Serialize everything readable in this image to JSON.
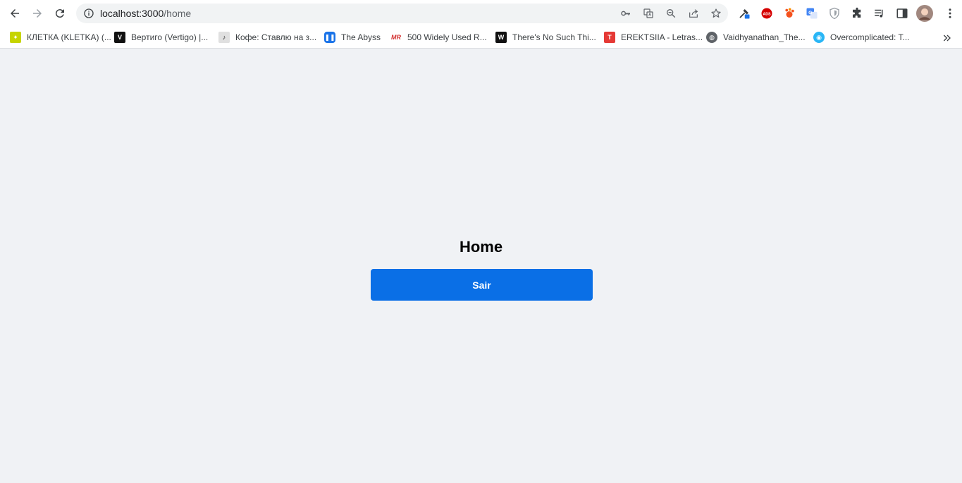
{
  "browser": {
    "url_host": "localhost:3000",
    "url_path": "/home",
    "bookmarks": [
      {
        "label": "КЛЕТКА (KLETKA) (...",
        "icon": "kletka-favicon",
        "color": "#c6d400"
      },
      {
        "label": "Вертиго (Vertigo) |...",
        "icon": "vertigo-favicon",
        "color": "#111111"
      },
      {
        "label": "Кофе: Ставлю на з...",
        "icon": "music-note-favicon",
        "color": "#9e9e9e"
      },
      {
        "label": "The Abyss",
        "icon": "pause-favicon",
        "color": "#1a73e8"
      },
      {
        "label": "500 Widely Used R...",
        "icon": "mr-favicon",
        "color": "#d32f2f"
      },
      {
        "label": "There's No Such Thi...",
        "icon": "book-favicon",
        "color": "#111111"
      },
      {
        "label": "EREKTSIIA - Letras...",
        "icon": "letras-favicon",
        "color": "#e53935"
      },
      {
        "label": "Vaidhyanathan_The...",
        "icon": "globe-favicon",
        "color": "#5f6368"
      },
      {
        "label": "Overcomplicated: T...",
        "icon": "site-favicon",
        "color": "#29b6f6"
      }
    ]
  },
  "page": {
    "title": "Home",
    "button_label": "Sair",
    "button_color": "#0a6fe6",
    "background": "#f0f2f5"
  }
}
